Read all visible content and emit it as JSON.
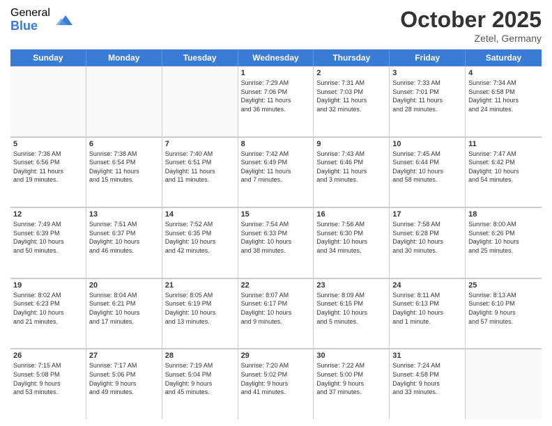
{
  "logo": {
    "general": "General",
    "blue": "Blue"
  },
  "title": "October 2025",
  "location": "Zetel, Germany",
  "header_days": [
    "Sunday",
    "Monday",
    "Tuesday",
    "Wednesday",
    "Thursday",
    "Friday",
    "Saturday"
  ],
  "weeks": [
    [
      {
        "day": "",
        "info": ""
      },
      {
        "day": "",
        "info": ""
      },
      {
        "day": "",
        "info": ""
      },
      {
        "day": "1",
        "info": "Sunrise: 7:29 AM\nSunset: 7:06 PM\nDaylight: 11 hours\nand 36 minutes."
      },
      {
        "day": "2",
        "info": "Sunrise: 7:31 AM\nSunset: 7:03 PM\nDaylight: 11 hours\nand 32 minutes."
      },
      {
        "day": "3",
        "info": "Sunrise: 7:33 AM\nSunset: 7:01 PM\nDaylight: 11 hours\nand 28 minutes."
      },
      {
        "day": "4",
        "info": "Sunrise: 7:34 AM\nSunset: 6:58 PM\nDaylight: 11 hours\nand 24 minutes."
      }
    ],
    [
      {
        "day": "5",
        "info": "Sunrise: 7:36 AM\nSunset: 6:56 PM\nDaylight: 11 hours\nand 19 minutes."
      },
      {
        "day": "6",
        "info": "Sunrise: 7:38 AM\nSunset: 6:54 PM\nDaylight: 11 hours\nand 15 minutes."
      },
      {
        "day": "7",
        "info": "Sunrise: 7:40 AM\nSunset: 6:51 PM\nDaylight: 11 hours\nand 11 minutes."
      },
      {
        "day": "8",
        "info": "Sunrise: 7:42 AM\nSunset: 6:49 PM\nDaylight: 11 hours\nand 7 minutes."
      },
      {
        "day": "9",
        "info": "Sunrise: 7:43 AM\nSunset: 6:46 PM\nDaylight: 11 hours\nand 3 minutes."
      },
      {
        "day": "10",
        "info": "Sunrise: 7:45 AM\nSunset: 6:44 PM\nDaylight: 10 hours\nand 58 minutes."
      },
      {
        "day": "11",
        "info": "Sunrise: 7:47 AM\nSunset: 6:42 PM\nDaylight: 10 hours\nand 54 minutes."
      }
    ],
    [
      {
        "day": "12",
        "info": "Sunrise: 7:49 AM\nSunset: 6:39 PM\nDaylight: 10 hours\nand 50 minutes."
      },
      {
        "day": "13",
        "info": "Sunrise: 7:51 AM\nSunset: 6:37 PM\nDaylight: 10 hours\nand 46 minutes."
      },
      {
        "day": "14",
        "info": "Sunrise: 7:52 AM\nSunset: 6:35 PM\nDaylight: 10 hours\nand 42 minutes."
      },
      {
        "day": "15",
        "info": "Sunrise: 7:54 AM\nSunset: 6:33 PM\nDaylight: 10 hours\nand 38 minutes."
      },
      {
        "day": "16",
        "info": "Sunrise: 7:56 AM\nSunset: 6:30 PM\nDaylight: 10 hours\nand 34 minutes."
      },
      {
        "day": "17",
        "info": "Sunrise: 7:58 AM\nSunset: 6:28 PM\nDaylight: 10 hours\nand 30 minutes."
      },
      {
        "day": "18",
        "info": "Sunrise: 8:00 AM\nSunset: 6:26 PM\nDaylight: 10 hours\nand 25 minutes."
      }
    ],
    [
      {
        "day": "19",
        "info": "Sunrise: 8:02 AM\nSunset: 6:23 PM\nDaylight: 10 hours\nand 21 minutes."
      },
      {
        "day": "20",
        "info": "Sunrise: 8:04 AM\nSunset: 6:21 PM\nDaylight: 10 hours\nand 17 minutes."
      },
      {
        "day": "21",
        "info": "Sunrise: 8:05 AM\nSunset: 6:19 PM\nDaylight: 10 hours\nand 13 minutes."
      },
      {
        "day": "22",
        "info": "Sunrise: 8:07 AM\nSunset: 6:17 PM\nDaylight: 10 hours\nand 9 minutes."
      },
      {
        "day": "23",
        "info": "Sunrise: 8:09 AM\nSunset: 6:15 PM\nDaylight: 10 hours\nand 5 minutes."
      },
      {
        "day": "24",
        "info": "Sunrise: 8:11 AM\nSunset: 6:13 PM\nDaylight: 10 hours\nand 1 minute."
      },
      {
        "day": "25",
        "info": "Sunrise: 8:13 AM\nSunset: 6:10 PM\nDaylight: 9 hours\nand 57 minutes."
      }
    ],
    [
      {
        "day": "26",
        "info": "Sunrise: 7:15 AM\nSunset: 5:08 PM\nDaylight: 9 hours\nand 53 minutes."
      },
      {
        "day": "27",
        "info": "Sunrise: 7:17 AM\nSunset: 5:06 PM\nDaylight: 9 hours\nand 49 minutes."
      },
      {
        "day": "28",
        "info": "Sunrise: 7:19 AM\nSunset: 5:04 PM\nDaylight: 9 hours\nand 45 minutes."
      },
      {
        "day": "29",
        "info": "Sunrise: 7:20 AM\nSunset: 5:02 PM\nDaylight: 9 hours\nand 41 minutes."
      },
      {
        "day": "30",
        "info": "Sunrise: 7:22 AM\nSunset: 5:00 PM\nDaylight: 9 hours\nand 37 minutes."
      },
      {
        "day": "31",
        "info": "Sunrise: 7:24 AM\nSunset: 4:58 PM\nDaylight: 9 hours\nand 33 minutes."
      },
      {
        "day": "",
        "info": ""
      }
    ]
  ]
}
